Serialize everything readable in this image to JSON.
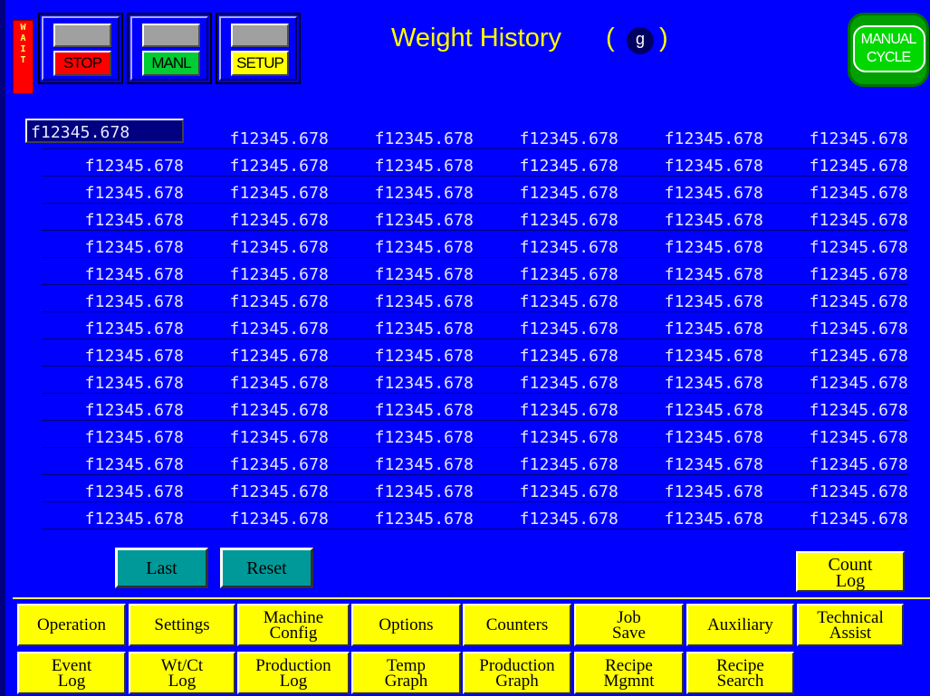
{
  "header": {
    "wait_letters": [
      "W",
      "A",
      "I",
      "T"
    ],
    "buttons": [
      {
        "label": "STOP",
        "color": "#FF0000"
      },
      {
        "label": "MANL",
        "color": "#00CC33"
      },
      {
        "label": "SETUP",
        "color": "#FFFF00"
      }
    ],
    "title": "Weight History",
    "paren_open": "(",
    "unit": "g",
    "paren_close": ")",
    "manual_cycle": {
      "line1": "MANUAL",
      "line2": "CYCLE"
    }
  },
  "weights": [
    [
      "f12345.678",
      "f12345.678",
      "f12345.678",
      "f12345.678",
      "f12345.678",
      "f12345.678"
    ],
    [
      "f12345.678",
      "f12345.678",
      "f12345.678",
      "f12345.678",
      "f12345.678",
      "f12345.678"
    ],
    [
      "f12345.678",
      "f12345.678",
      "f12345.678",
      "f12345.678",
      "f12345.678",
      "f12345.678"
    ],
    [
      "f12345.678",
      "f12345.678",
      "f12345.678",
      "f12345.678",
      "f12345.678",
      "f12345.678"
    ],
    [
      "f12345.678",
      "f12345.678",
      "f12345.678",
      "f12345.678",
      "f12345.678",
      "f12345.678"
    ],
    [
      "f12345.678",
      "f12345.678",
      "f12345.678",
      "f12345.678",
      "f12345.678",
      "f12345.678"
    ],
    [
      "f12345.678",
      "f12345.678",
      "f12345.678",
      "f12345.678",
      "f12345.678",
      "f12345.678"
    ],
    [
      "f12345.678",
      "f12345.678",
      "f12345.678",
      "f12345.678",
      "f12345.678",
      "f12345.678"
    ],
    [
      "f12345.678",
      "f12345.678",
      "f12345.678",
      "f12345.678",
      "f12345.678",
      "f12345.678"
    ],
    [
      "f12345.678",
      "f12345.678",
      "f12345.678",
      "f12345.678",
      "f12345.678",
      "f12345.678"
    ],
    [
      "f12345.678",
      "f12345.678",
      "f12345.678",
      "f12345.678",
      "f12345.678",
      "f12345.678"
    ],
    [
      "f12345.678",
      "f12345.678",
      "f12345.678",
      "f12345.678",
      "f12345.678",
      "f12345.678"
    ],
    [
      "f12345.678",
      "f12345.678",
      "f12345.678",
      "f12345.678",
      "f12345.678",
      "f12345.678"
    ],
    [
      "f12345.678",
      "f12345.678",
      "f12345.678",
      "f12345.678",
      "f12345.678",
      "f12345.678"
    ],
    [
      "f12345.678",
      "f12345.678",
      "f12345.678",
      "f12345.678",
      "f12345.678",
      "f12345.678"
    ]
  ],
  "controls": {
    "last_label": "Last",
    "reset_label": "Reset",
    "count_log": {
      "line1": "Count",
      "line2": "Log"
    }
  },
  "nav_row1": [
    {
      "line1": "Operation",
      "line2": ""
    },
    {
      "line1": "Settings",
      "line2": ""
    },
    {
      "line1": "Machine",
      "line2": "Config"
    },
    {
      "line1": "Options",
      "line2": ""
    },
    {
      "line1": "Counters",
      "line2": ""
    },
    {
      "line1": "Job",
      "line2": "Save"
    },
    {
      "line1": "Auxiliary",
      "line2": ""
    },
    {
      "line1": "Technical",
      "line2": "Assist"
    }
  ],
  "nav_row2": [
    {
      "line1": "Event",
      "line2": "Log"
    },
    {
      "line1": "Wt/Ct",
      "line2": "Log"
    },
    {
      "line1": "Production",
      "line2": "Log"
    },
    {
      "line1": "Temp",
      "line2": "Graph"
    },
    {
      "line1": "Production",
      "line2": "Graph"
    },
    {
      "line1": "Recipe",
      "line2": "Mgmnt"
    },
    {
      "line1": "Recipe",
      "line2": "Search"
    }
  ],
  "colors": {
    "background": "#0000FF",
    "accent_yellow": "#FFFF00",
    "teal_button": "#009999",
    "text_light": "#E8E8FF"
  }
}
